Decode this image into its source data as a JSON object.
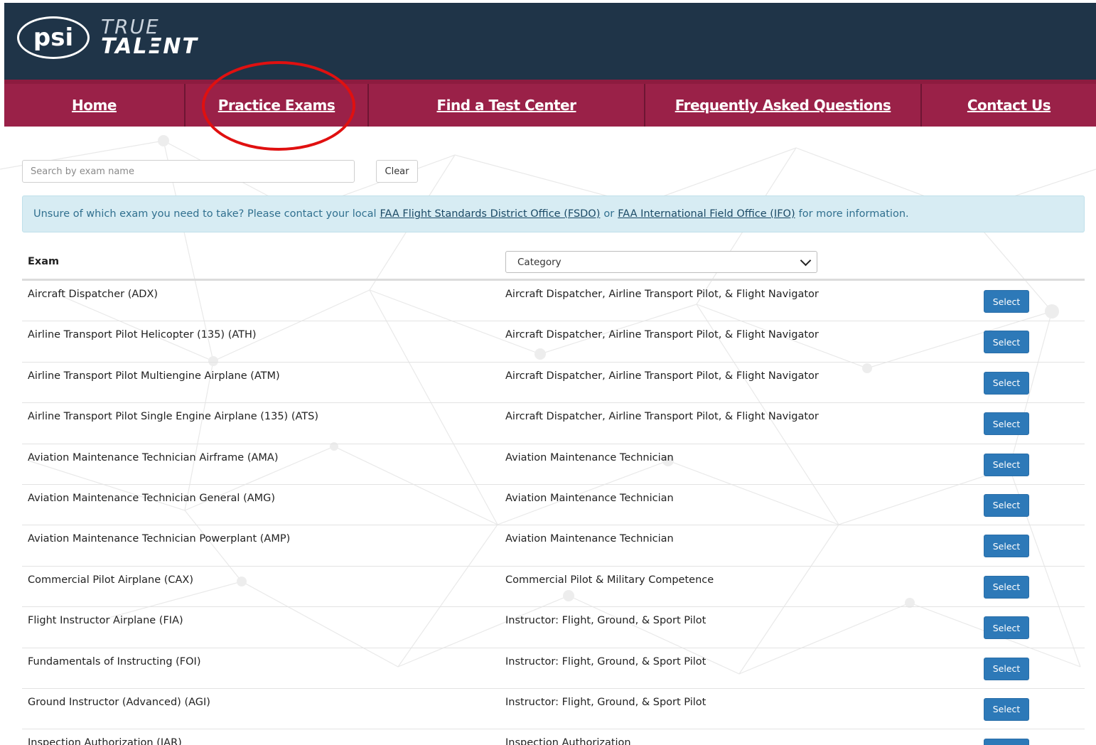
{
  "brand": {
    "mark": "psi",
    "line1": "TRUE",
    "line2": "TALΞNT"
  },
  "nav": {
    "items": [
      {
        "label": "Home"
      },
      {
        "label": "Practice Exams"
      },
      {
        "label": "Find a Test Center"
      },
      {
        "label": "Frequently Asked Questions"
      },
      {
        "label": "Contact Us"
      }
    ]
  },
  "search": {
    "placeholder": "Search by exam name",
    "value": "",
    "clear_label": "Clear"
  },
  "alert": {
    "text_before": "Unsure of which exam you need to take? Please contact your local",
    "link1": "FAA Flight Standards District Office (FSDO)",
    "middle": "or",
    "link2": "FAA International Field Office (IFO)",
    "text_after": "for more information."
  },
  "table": {
    "exam_header": "Exam",
    "category_select": "Category",
    "select_label": "Select",
    "rows": [
      {
        "exam": "Aircraft Dispatcher (ADX)",
        "category": "Aircraft Dispatcher, Airline Transport Pilot, & Flight Navigator"
      },
      {
        "exam": "Airline Transport Pilot Helicopter (135) (ATH)",
        "category": "Aircraft Dispatcher, Airline Transport Pilot, & Flight Navigator"
      },
      {
        "exam": "Airline Transport Pilot Multiengine Airplane (ATM)",
        "category": "Aircraft Dispatcher, Airline Transport Pilot, & Flight Navigator"
      },
      {
        "exam": "Airline Transport Pilot Single Engine Airplane (135) (ATS)",
        "category": "Aircraft Dispatcher, Airline Transport Pilot, & Flight Navigator"
      },
      {
        "exam": "Aviation Maintenance Technician Airframe (AMA)",
        "category": "Aviation Maintenance Technician"
      },
      {
        "exam": "Aviation Maintenance Technician General (AMG)",
        "category": "Aviation Maintenance Technician"
      },
      {
        "exam": "Aviation Maintenance Technician Powerplant (AMP)",
        "category": "Aviation Maintenance Technician"
      },
      {
        "exam": "Commercial Pilot Airplane (CAX)",
        "category": "Commercial Pilot & Military Competence"
      },
      {
        "exam": "Flight Instructor Airplane (FIA)",
        "category": "Instructor: Flight, Ground, & Sport Pilot"
      },
      {
        "exam": "Fundamentals of Instructing (FOI)",
        "category": "Instructor: Flight, Ground, & Sport Pilot"
      },
      {
        "exam": "Ground Instructor (Advanced) (AGI)",
        "category": "Instructor: Flight, Ground, & Sport Pilot"
      },
      {
        "exam": "Inspection Authorization (IAR)",
        "category": "Inspection Authorization"
      }
    ]
  },
  "colors": {
    "header_bg": "#1f3448",
    "nav_bg": "#9a2148",
    "select_btn": "#2d79b8",
    "alert_bg": "#d7ecf3",
    "annotation": "#e01010"
  }
}
